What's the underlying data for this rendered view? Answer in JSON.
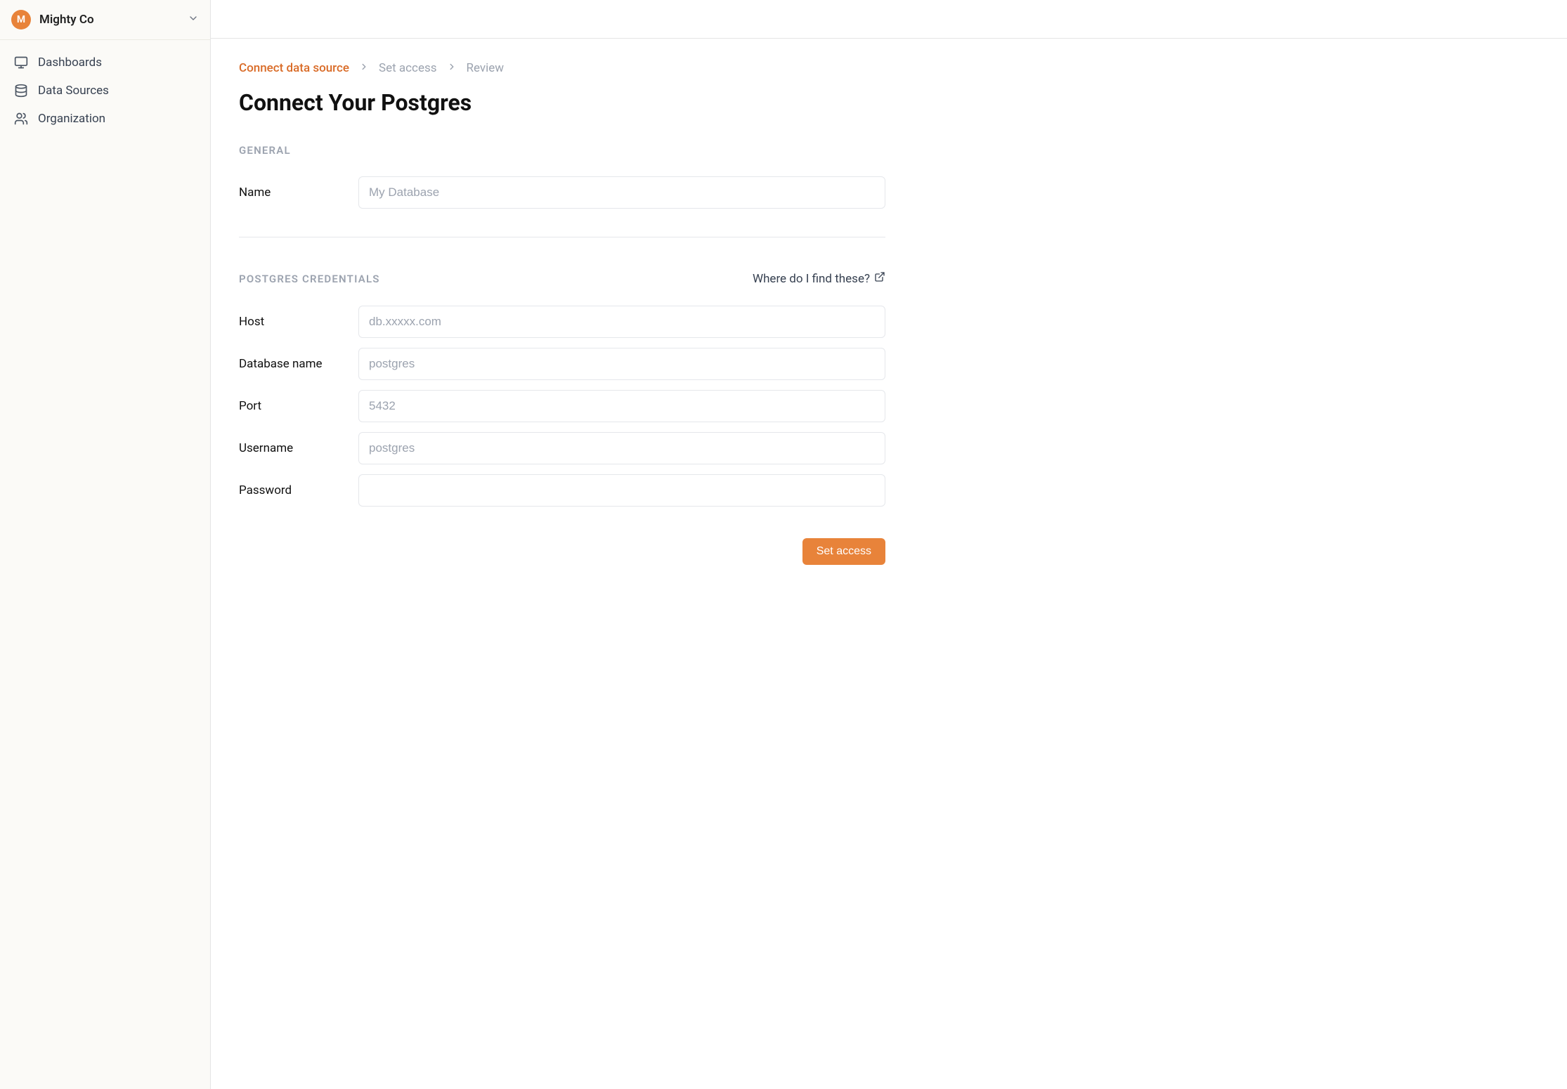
{
  "org": {
    "initial": "M",
    "name": "Mighty Co"
  },
  "sidebar": {
    "items": [
      {
        "label": "Dashboards"
      },
      {
        "label": "Data Sources"
      },
      {
        "label": "Organization"
      }
    ]
  },
  "breadcrumb": {
    "step1": "Connect data source",
    "step2": "Set access",
    "step3": "Review"
  },
  "page": {
    "title": "Connect Your Postgres"
  },
  "sections": {
    "general": {
      "label": "GENERAL",
      "name_label": "Name",
      "name_placeholder": "My Database"
    },
    "credentials": {
      "label": "POSTGRES CREDENTIALS",
      "help_text": "Where do I find these?",
      "host_label": "Host",
      "host_placeholder": "db.xxxxx.com",
      "dbname_label": "Database name",
      "dbname_placeholder": "postgres",
      "port_label": "Port",
      "port_placeholder": "5432",
      "username_label": "Username",
      "username_placeholder": "postgres",
      "password_label": "Password",
      "password_placeholder": ""
    }
  },
  "actions": {
    "primary": "Set access"
  }
}
